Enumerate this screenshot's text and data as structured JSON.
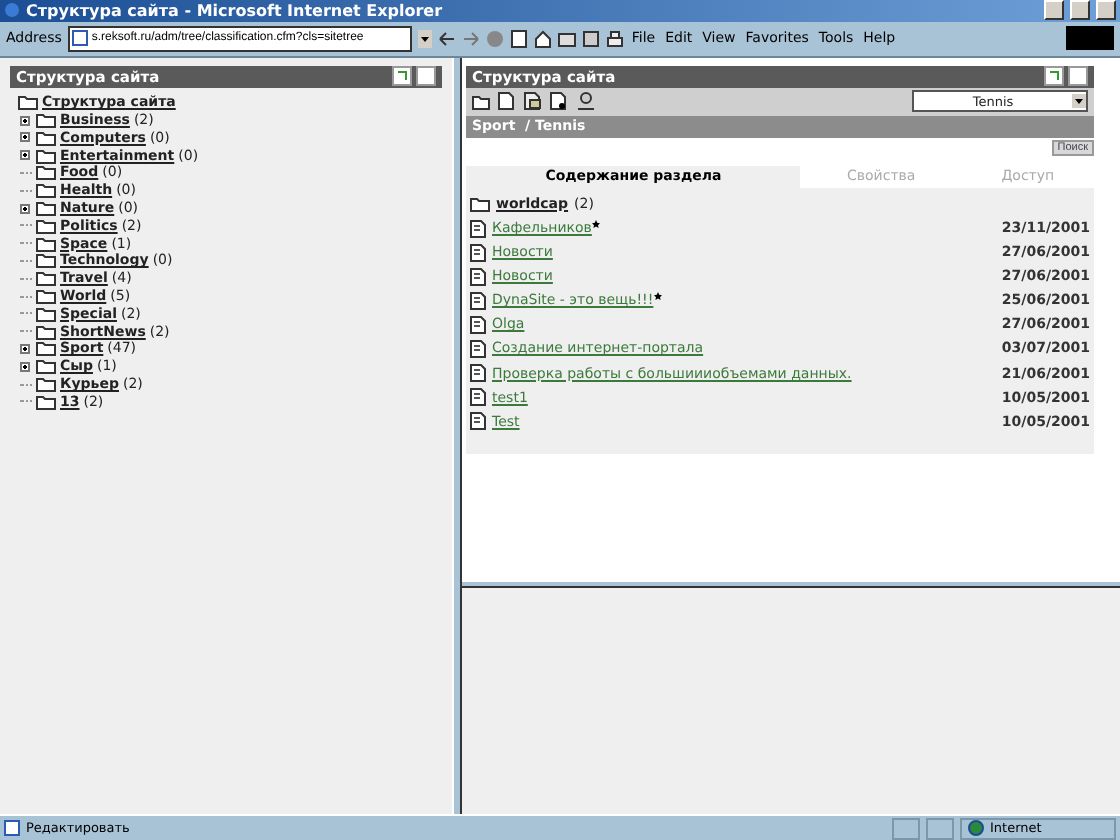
{
  "window": {
    "title": "Структура сайта - Microsoft Internet Explorer"
  },
  "toolbar": {
    "address_label": "Address",
    "address": "s.reksoft.ru/adm/tree/classification.cfm?cls=sitetree",
    "menu": [
      "File",
      "Edit",
      "View",
      "Favorites",
      "Tools",
      "Help"
    ]
  },
  "left_panel": {
    "title": "Структура сайта",
    "tree": {
      "label": "Структура сайта",
      "children": [
        {
          "label": "Business",
          "count": "(2)",
          "expandable": true
        },
        {
          "label": "Computers",
          "count": "(0)",
          "expandable": true
        },
        {
          "label": "Entertainment",
          "count": "(0)",
          "expandable": true
        },
        {
          "label": "Food",
          "count": "(0)",
          "expandable": false
        },
        {
          "label": "Health",
          "count": "(0)",
          "expandable": false
        },
        {
          "label": "Nature",
          "count": "(0)",
          "expandable": true
        },
        {
          "label": "Politics",
          "count": "(2)",
          "expandable": false
        },
        {
          "label": "Space",
          "count": "(1)",
          "expandable": false
        },
        {
          "label": "Technology",
          "count": "(0)",
          "expandable": false
        },
        {
          "label": "Travel",
          "count": "(4)",
          "expandable": false
        },
        {
          "label": "World",
          "count": "(5)",
          "expandable": false
        },
        {
          "label": "Special",
          "count": "(2)",
          "expandable": false
        },
        {
          "label": "ShortNews",
          "count": "(2)",
          "expandable": false
        },
        {
          "label": "Sport",
          "count": "(47)",
          "expandable": true
        },
        {
          "label": "Сыр",
          "count": "(1)",
          "expandable": true
        },
        {
          "label": "Курьер",
          "count": "(2)",
          "expandable": false
        },
        {
          "label": "13",
          "count": "(2)",
          "expandable": false
        }
      ]
    }
  },
  "right_panel": {
    "title": "Структура сайта",
    "section_select": "Tennis",
    "breadcrumb": "Sport  / Tennis",
    "search_button": "Поиск",
    "tabs": [
      {
        "label": "Содержание раздела",
        "selected": true
      },
      {
        "label": "Свойства",
        "selected": false
      },
      {
        "label": "Доступ",
        "selected": false
      }
    ],
    "items": [
      {
        "kind": "folder",
        "label": "worldcap",
        "count": "(2)"
      },
      {
        "kind": "document",
        "label": "Кафельников",
        "starred": true,
        "date": "23/11/2001"
      },
      {
        "kind": "document",
        "label": "Новости",
        "starred": false,
        "date": "27/06/2001"
      },
      {
        "kind": "document",
        "label": "Новости",
        "starred": false,
        "date": "27/06/2001"
      },
      {
        "kind": "document",
        "label": "DynaSite - это вещь!!!",
        "starred": true,
        "date": "25/06/2001"
      },
      {
        "kind": "document",
        "label": "Olga",
        "starred": false,
        "date": "27/06/2001"
      },
      {
        "kind": "document",
        "label": "Создание интернет-портала",
        "starred": false,
        "date": "03/07/2001"
      },
      {
        "kind": "document",
        "label": "Проверка работы с большиииобъемами данных.",
        "starred": false,
        "date": "21/06/2001"
      },
      {
        "kind": "document",
        "label": "test1",
        "starred": false,
        "date": "10/05/2001"
      },
      {
        "kind": "document",
        "label": "Test",
        "starred": false,
        "date": "10/05/2001"
      }
    ]
  },
  "status_bar": {
    "text": "Редактировать",
    "zone": "Internet"
  }
}
